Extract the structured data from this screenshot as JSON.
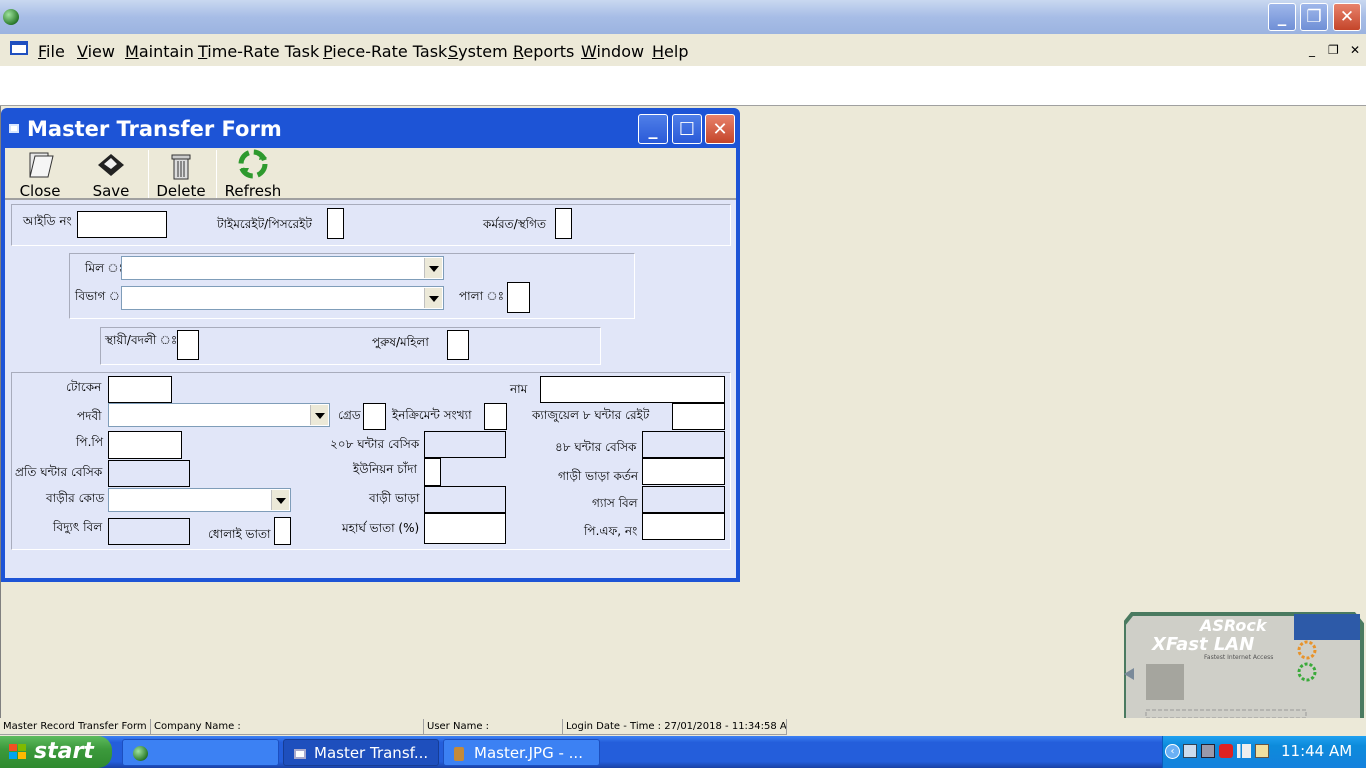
{
  "menu": {
    "items": [
      "File",
      "View",
      "Maintain",
      "Time-Rate Task",
      "Piece-Rate Task",
      "System",
      "Reports",
      "Window",
      "Help"
    ]
  },
  "form": {
    "title": "Master Transfer Form",
    "toolbar": {
      "close": "Close",
      "save": "Save",
      "delete": "Delete",
      "refresh": "Refresh"
    },
    "labels": {
      "id_no": "আইডি নং",
      "time_piece": "টাইমরেইট/পিসরেইট",
      "active_suspended": "কর্মরত/স্থগিত",
      "mill": "মিল ঃ",
      "department": "বিভাগ ঃ",
      "shift": "পালা ঃ",
      "permanent_badli": "স্থায়ী/বদলী ঃ",
      "male_female": "পুরুষ/মহিলা",
      "token": "টোকেন",
      "name": "নাম",
      "designation": "পদবী",
      "grade": "গ্রেড",
      "increment_count": "ইনক্রিমেন্ট সংখ্যা",
      "casual_rate": "ক্যাজুয়েল ৮ ঘন্টার রেইট",
      "pf": "পি.পি",
      "basic_208": "২০৮ ঘন্টার বেসিক",
      "basic_48": "৪৮ ঘন্টার বেসিক",
      "hourly_basic": "প্রতি ঘন্টার বেসিক",
      "union_fee": "ইউনিয়ন চাঁদা",
      "transport_deduction": "গাড়ী ভাড়া কর্তন",
      "house_code": "বাড়ীর কোড",
      "house_rent": "বাড়ী ভাড়া",
      "gas_bill": "গ্যাস বিল",
      "electricity_bill": "বিদ্যুৎ বিল",
      "washing_allowance": "ধোলাই ভাতা",
      "dearness_allowance": "মহার্ঘ ভাতা (%)",
      "pf_no": "পি.এফ, নং"
    }
  },
  "statusbar": {
    "form_name": "Master Record Transfer Form",
    "company": "Company Name :",
    "user": "User Name :",
    "login": "Login Date - Time : 27/01/2018 - 11:34:58 AM"
  },
  "taskbar": {
    "start": "start",
    "tasks": [
      "Master Transf...",
      "Master.JPG - ..."
    ],
    "clock": "11:44 AM"
  },
  "widget": {
    "brand": "ASRock",
    "product": "XFast LAN",
    "tagline": "Fastest Internet Access"
  }
}
